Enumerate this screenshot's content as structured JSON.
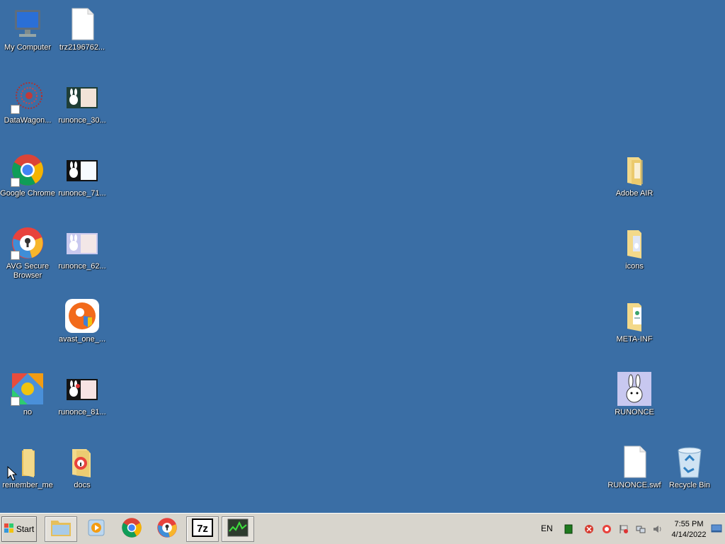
{
  "desktop": {
    "icons": {
      "my_computer": "My Computer",
      "trz_file": "trz2196762...",
      "datawagon": "DataWagon...",
      "runonce_30": "runonce_30...",
      "google_chrome": "Google Chrome",
      "runonce_71": "runonce_71...",
      "avg_browser": "AVG Secure\nBrowser",
      "runonce_62": "runonce_62...",
      "avast_one": "avast_one_...",
      "no": "no",
      "runonce_81": "runonce_81...",
      "remember_me": "remember_me",
      "docs": "docs",
      "adobe_air": "Adobe AIR",
      "icons_folder": "icons",
      "meta_inf": "META-INF",
      "runonce_app": "RUNONCE",
      "runonce_swf": "RUNONCE.swf",
      "recycle_bin": "Recycle Bin"
    }
  },
  "taskbar": {
    "start_label": "Start",
    "language": "EN",
    "clock_time": "7:55 PM",
    "clock_date": "4/14/2022"
  },
  "colors": {
    "desktop_bg": "#3a6ea5",
    "taskbar_bg": "#d8d5cd",
    "folder": "#f0d27a"
  }
}
